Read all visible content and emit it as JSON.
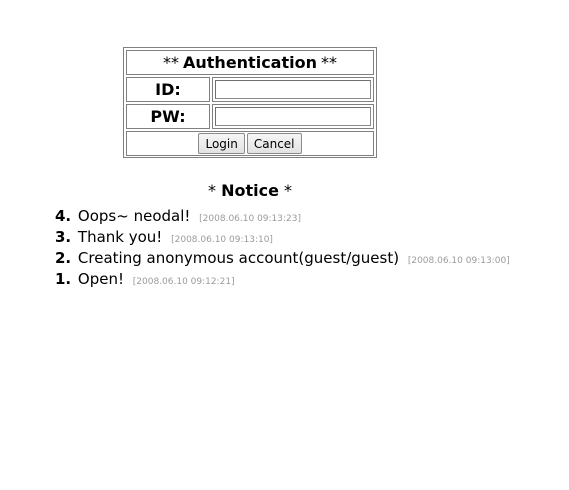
{
  "auth": {
    "title_prefix": "**",
    "title": "Authentication",
    "title_suffix": "**",
    "id_label": "ID:",
    "pw_label": "PW:",
    "id_value": "",
    "pw_value": "",
    "login_label": "Login",
    "cancel_label": "Cancel"
  },
  "notice": {
    "title_prefix": "*",
    "title": "Notice",
    "title_suffix": "*",
    "items": [
      {
        "num": "4.",
        "text": "Oops~ neodal!",
        "date": "[2008.06.10 09:13:23]"
      },
      {
        "num": "3.",
        "text": "Thank you!",
        "date": "[2008.06.10 09:13:10]"
      },
      {
        "num": "2.",
        "text": "Creating anonymous account(guest/guest)",
        "date": "[2008.06.10 09:13:00]"
      },
      {
        "num": "1.",
        "text": "Open!",
        "date": "[2008.06.10 09:12:21]"
      }
    ]
  }
}
